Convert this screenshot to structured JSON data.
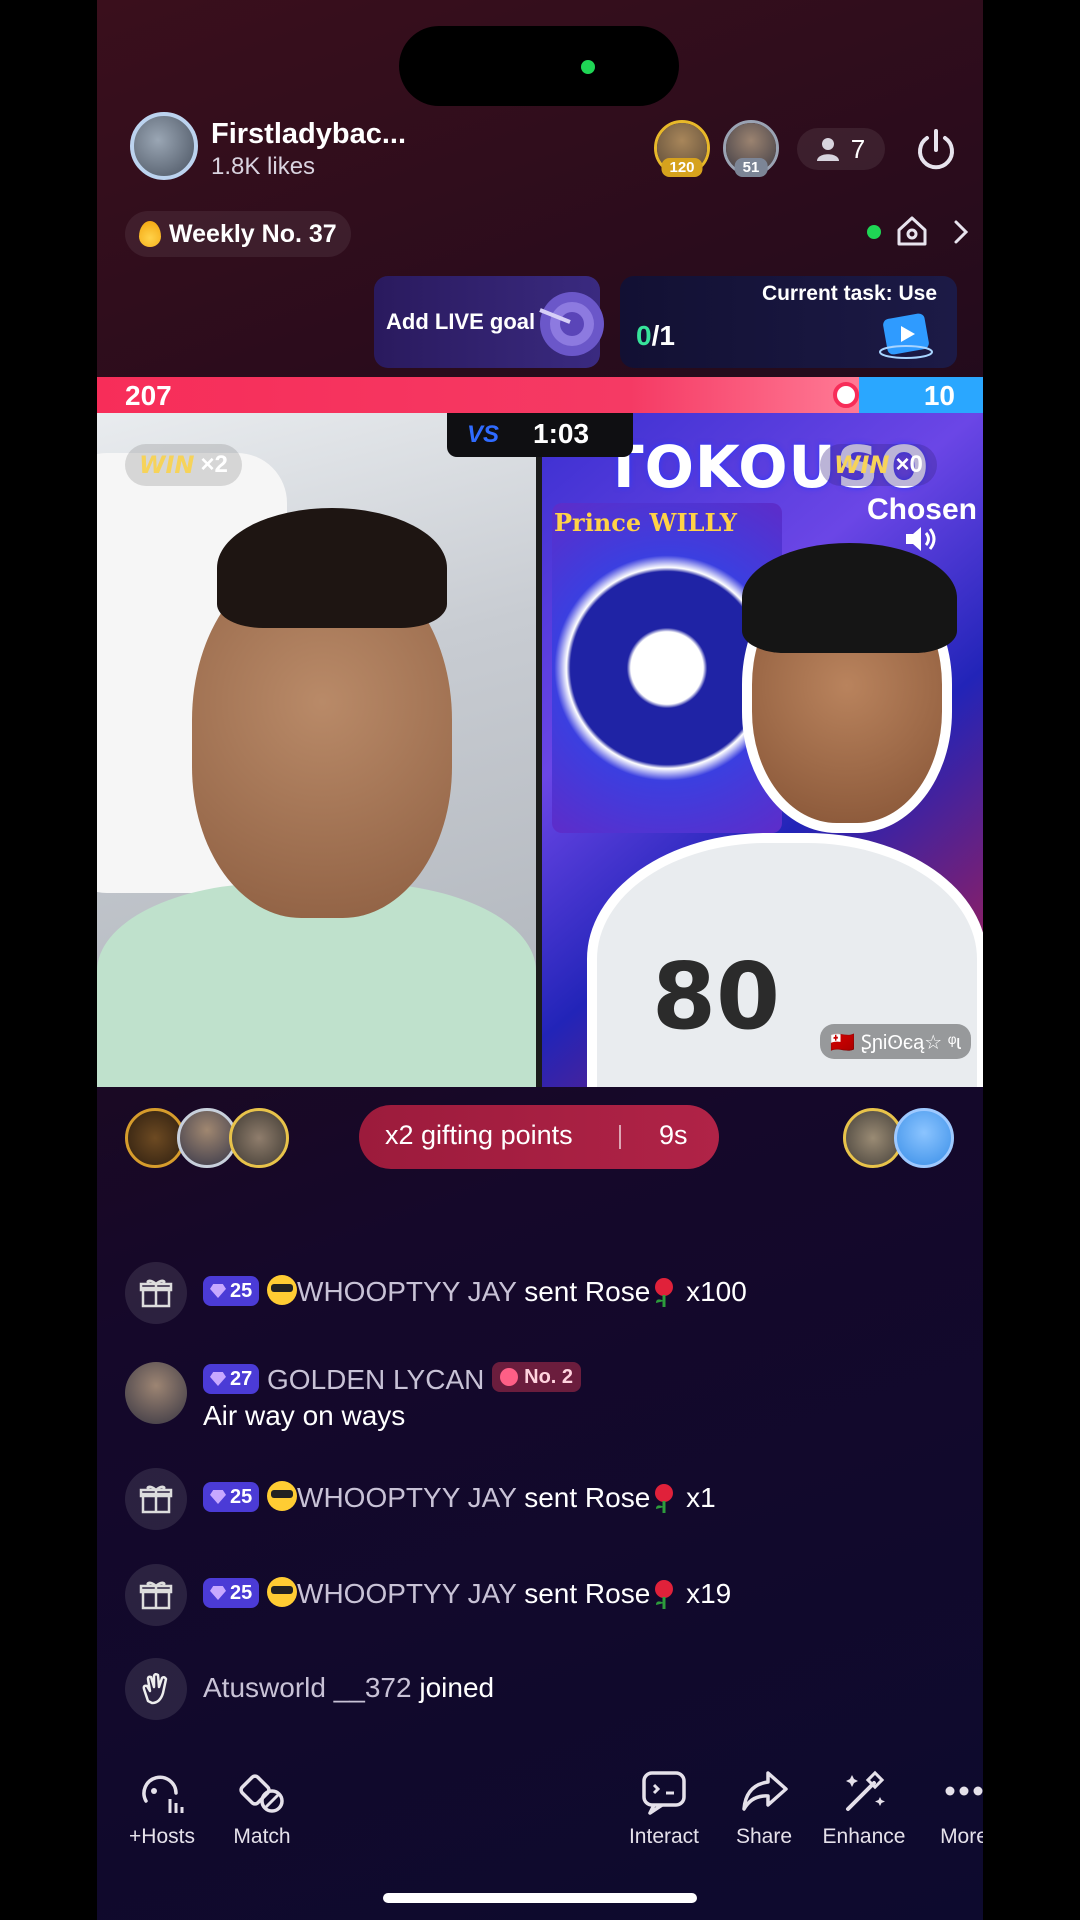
{
  "header": {
    "host_name": "Firstladybac...",
    "host_likes": "1.8K likes",
    "top_viewers": [
      {
        "badge": "120"
      },
      {
        "badge": "51"
      }
    ],
    "viewer_count": "7"
  },
  "ranking": {
    "weekly_label": "Weekly No. 37"
  },
  "goals": {
    "add_live_goal": "Add LIVE goal",
    "current_task": "Current task: Use",
    "progress_done": "0",
    "progress_total": "/1"
  },
  "battle": {
    "score_left": "207",
    "score_right": "10",
    "score_left_fraction": 0.954,
    "timer": "1:03",
    "vs_label": "VS",
    "left_win": {
      "w": "WIN",
      "x": "×2"
    },
    "right_win": {
      "w": "WIN",
      "x": "×0"
    },
    "right_pane": {
      "title": "TOKOUSO",
      "sub1": "Prince WILLY",
      "sub2": "Chosen",
      "jersey": "80",
      "name_tag": "🇹🇴 Ʂɲiʘєą☆ ᵠɩ"
    }
  },
  "boost": {
    "label": "x2 gifting points",
    "seconds": "9s"
  },
  "chat": [
    {
      "type": "gift",
      "level": "25",
      "user": "WHOOPTYY JAY",
      "text": "sent Rose",
      "count": "x100"
    },
    {
      "type": "comment",
      "level": "27",
      "user": "GOLDEN LYCAN",
      "rank": "No. 2",
      "text": "Air way on ways"
    },
    {
      "type": "gift",
      "level": "25",
      "user": "WHOOPTYY JAY",
      "text": "sent Rose",
      "count": "x1"
    },
    {
      "type": "gift",
      "level": "25",
      "user": "WHOOPTYY JAY",
      "text": "sent Rose",
      "count": "x19"
    },
    {
      "type": "join",
      "user": "Atusworld __372",
      "text": "joined"
    }
  ],
  "toolbar": {
    "hosts": "+Hosts",
    "match": "Match",
    "interact": "Interact",
    "share": "Share",
    "enhance": "Enhance",
    "more": "More"
  },
  "colors": {
    "score_red": "#f72d59",
    "score_blue": "#2aa7ff",
    "status_green": "#1fd655",
    "level_purple": "#4b3bd6"
  }
}
